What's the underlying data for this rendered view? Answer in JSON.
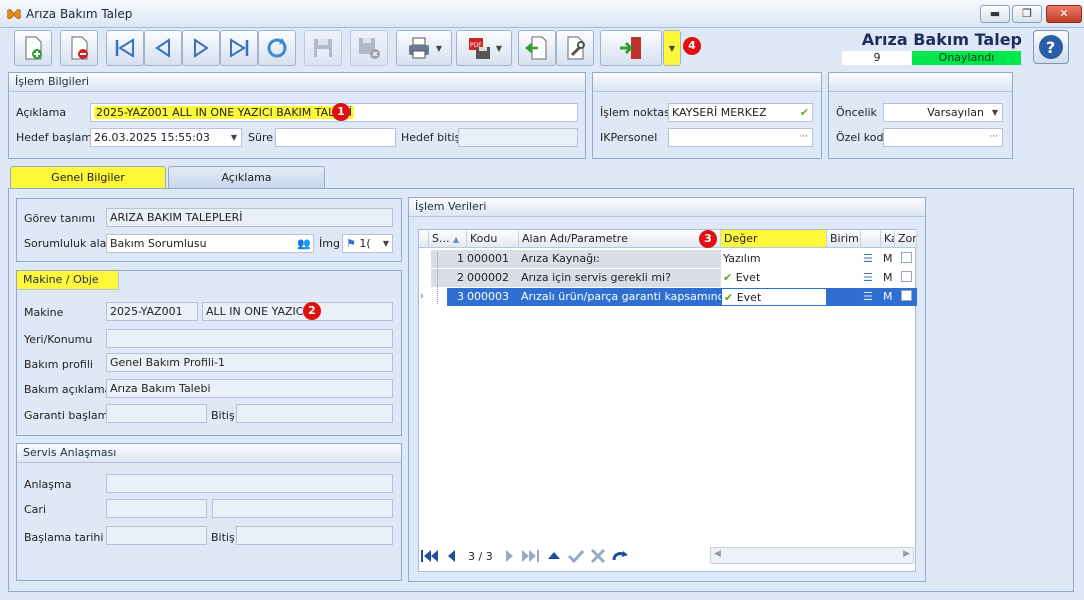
{
  "window": {
    "title": "Arıza Bakım Talep",
    "min_label": "▬",
    "max_label": "❐",
    "close_label": "✕"
  },
  "header": {
    "title": "Arıza Bakım Talep",
    "number": "9",
    "status": "Onaylandı",
    "status_color": "#00e64d",
    "help_label": "?"
  },
  "toolbar": {
    "buttons": [
      "new",
      "delete",
      "first",
      "previous",
      "next",
      "last",
      "refresh",
      "save",
      "save-close",
      "print",
      "pdf",
      "import",
      "tools",
      "exit"
    ],
    "badge_exit": "4"
  },
  "islem_bilgileri": {
    "title": "İşlem Bilgileri",
    "aciklama_label": "Açıklama",
    "aciklama_value": "2025-YAZ001 ALL IN ONE YAZICI BAKIM TALEBİ",
    "badge": "1",
    "hedef_baslama_label": "Hedef başlama",
    "hedef_baslama_value": "26.03.2025 15:55:03",
    "sure_label": "Süre",
    "sure_value": "",
    "hedef_bitis_label": "Hedef bitiş",
    "hedef_bitis_value": ""
  },
  "islem_noktasi": {
    "label": "İşlem noktası",
    "value": "KAYSERİ MERKEZ",
    "ikpersonel_label": "IKPersonel",
    "ikpersonel_value": "",
    "ellipsis": "···"
  },
  "oncelik": {
    "label": "Öncelik",
    "value": "Varsayılan",
    "ozel_kod_label": "Özel kod",
    "ozel_kod_value": "",
    "ellipsis": "···"
  },
  "tabs": [
    {
      "label": "Genel Bilgiler",
      "active": true
    },
    {
      "label": "Açıklama",
      "active": false
    }
  ],
  "gorev": {
    "gorev_tanimi_label": "Görev tanımı",
    "gorev_tanimi_value": "ARIZA BAKIM TALEPLERİ",
    "sorumluluk_label": "Sorumluluk alanı",
    "sorumluluk_value": "Bakım Sorumlusu",
    "img_label": "İmg",
    "img_value": "1("
  },
  "makine_obje": {
    "title": "Makine / Obje",
    "makine_label": "Makine",
    "makine_code": "2025-YAZ001",
    "makine_name": "ALL IN ONE YAZICI",
    "badge": "2",
    "yeri_label": "Yeri/Konumu",
    "yeri_value": "",
    "bakim_profili_label": "Bakım profili",
    "bakim_profili_value": "Genel Bakım Profili-1",
    "bakim_aciklama_label": "Bakım açıklama",
    "bakim_aciklama_value": "Arıza Bakım Talebi",
    "garanti_label": "Garanti başlama",
    "garanti_value": "",
    "bitis_label": "Bitiş",
    "bitis_value": ""
  },
  "servis": {
    "title": "Servis Anlaşması",
    "anlasma_label": "Anlaşma",
    "cari_label": "Cari",
    "baslama_label": "Başlama tarihi",
    "bitis_label": "Bitiş"
  },
  "islem_verileri": {
    "title": "İşlem Verileri",
    "badge": "3",
    "columns": [
      "S...",
      "Kodu",
      "Alan Adı/Parametre",
      "Değer",
      "Birim",
      "Ka",
      "Zor"
    ],
    "rows": [
      {
        "s": "1",
        "kodu": "000001",
        "alan": "Arıza Kaynağı:",
        "deger": "Yazılım",
        "check": false,
        "ka": "M",
        "selected": false
      },
      {
        "s": "2",
        "kodu": "000002",
        "alan": "Arıza için servis gerekli mi?",
        "deger": "Evet",
        "check": true,
        "ka": "M",
        "selected": false
      },
      {
        "s": "3",
        "kodu": "000003",
        "alan": "Arızalı ürün/parça garanti kapsamında mı?",
        "deger": "Evet",
        "check": true,
        "ka": "M",
        "selected": true
      }
    ],
    "pager": "3 / 3"
  }
}
